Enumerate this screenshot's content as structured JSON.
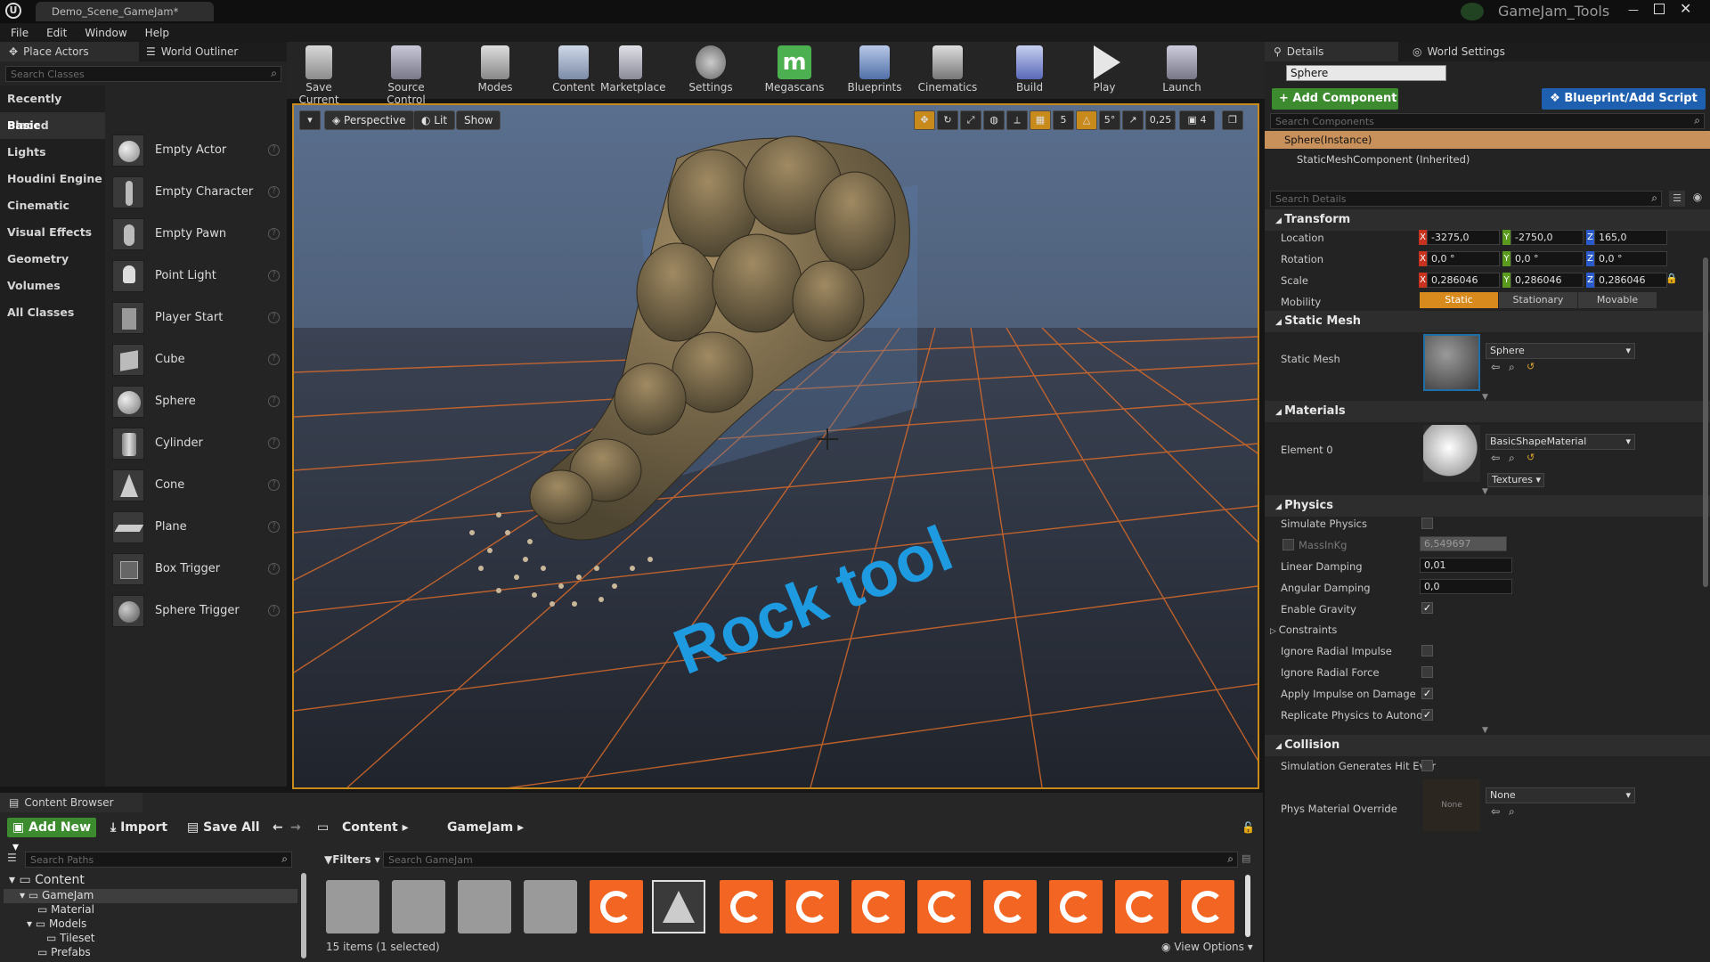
{
  "window": {
    "tab_title": "Demo_Scene_GameJam*",
    "project_name": "GameJam_Tools",
    "menu": [
      "File",
      "Edit",
      "Window",
      "Help"
    ]
  },
  "place_actors": {
    "tab_label": "Place Actors",
    "outliner_tab_label": "World Outliner",
    "search_placeholder": "Search Classes",
    "categories": [
      "Recently Placed",
      "Basic",
      "Lights",
      "Houdini Engine",
      "Cinematic",
      "Visual Effects",
      "Geometry",
      "Volumes",
      "All Classes"
    ],
    "selected_category": "Basic",
    "actors": [
      "Empty Actor",
      "Empty Character",
      "Empty Pawn",
      "Point Light",
      "Player Start",
      "Cube",
      "Sphere",
      "Cylinder",
      "Cone",
      "Plane",
      "Box Trigger",
      "Sphere Trigger"
    ]
  },
  "toolbar": {
    "buttons": [
      "Save Current",
      "Source Control",
      "Modes",
      "Content",
      "Marketplace",
      "Settings",
      "Megascans",
      "Blueprints",
      "Cinematics",
      "Build",
      "Play",
      "Launch"
    ]
  },
  "viewport": {
    "perspective_label": "Perspective",
    "lit_label": "Lit",
    "show_label": "Show",
    "grid_snap": "5",
    "rotation_snap": "5°",
    "scale_snap": "0,25",
    "camera_speed": "4",
    "scene_text": "Rock tool"
  },
  "details": {
    "tab_label": "Details",
    "world_settings_label": "World Settings",
    "actor_name": "Sphere",
    "add_component_label": "+ Add Component",
    "blueprint_label": "Blueprint/Add Script",
    "search_components_placeholder": "Search Components",
    "components": [
      "Sphere(Instance)",
      "StaticMeshComponent (Inherited)"
    ],
    "search_details_placeholder": "Search Details",
    "transform": {
      "header": "Transform",
      "location_label": "Location",
      "rotation_label": "Rotation",
      "scale_label": "Scale",
      "mobility_label": "Mobility",
      "location": [
        "-3275,0",
        "-2750,0",
        "165,0"
      ],
      "rotation": [
        "0,0 °",
        "0,0 °",
        "0,0 °"
      ],
      "scale": [
        "0,286046",
        "0,286046",
        "0,286046"
      ],
      "mobility_options": [
        "Static",
        "Stationary",
        "Movable"
      ],
      "mobility_selected": "Static"
    },
    "static_mesh": {
      "header": "Static Mesh",
      "label": "Static Mesh",
      "value": "Sphere"
    },
    "materials": {
      "header": "Materials",
      "label": "Element 0",
      "value": "BasicShapeMaterial",
      "textures_label": "Textures"
    },
    "physics": {
      "header": "Physics",
      "simulate_physics": "Simulate Physics",
      "mass_label": "MassInKg",
      "mass_value": "6,549697",
      "linear_damping_label": "Linear Damping",
      "linear_damping": "0,01",
      "angular_damping_label": "Angular Damping",
      "angular_damping": "0,0",
      "enable_gravity": "Enable Gravity",
      "constraints": "Constraints",
      "ignore_radial_impulse": "Ignore Radial Impulse",
      "ignore_radial_force": "Ignore Radial Force",
      "apply_impulse": "Apply Impulse on Damage",
      "replicate_physics": "Replicate Physics to Autonom"
    },
    "collision": {
      "header": "Collision",
      "sim_hit_events": "Simulation Generates Hit Ever",
      "phys_material_label": "Phys Material Override",
      "phys_material_value": "None",
      "thumb_label": "None"
    }
  },
  "content_browser": {
    "tab_label": "Content Browser",
    "add_new_label": "Add New",
    "import_label": "Import",
    "save_all_label": "Save All",
    "path": [
      "Content",
      "GameJam"
    ],
    "search_paths_placeholder": "Search Paths",
    "filters_label": "Filters",
    "search_placeholder": "Search GameJam",
    "tree": [
      "Content",
      "GameJam",
      "Material",
      "Models",
      "Tileset",
      "Prefabs"
    ],
    "status": "15 items (1 selected)",
    "view_options_label": "View Options"
  },
  "colors": {
    "accent_orange": "#c98a1c",
    "add_component_green": "#3c8b2f",
    "blueprint_blue": "#1f5fb0",
    "houdini_orange": "#f26522",
    "text_blue": "#1e9be0"
  }
}
